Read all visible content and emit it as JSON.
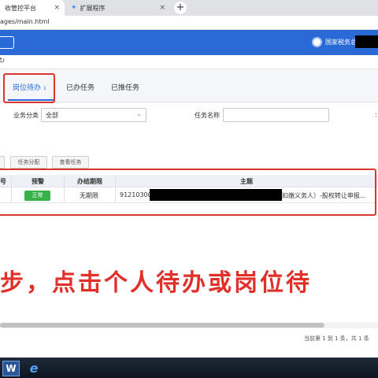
{
  "browser": {
    "tabs": [
      {
        "title": "收管控平台",
        "close": "×"
      },
      {
        "title": "扩展程序",
        "close": "×"
      }
    ],
    "new_tab": "+",
    "url": "ages/main.html"
  },
  "header": {
    "user_name": "国家税务总"
  },
  "tabs": {
    "items": [
      {
        "label": "岗位待办",
        "badge": "1"
      },
      {
        "label": "已办任务"
      },
      {
        "label": "已推任务"
      }
    ]
  },
  "filters": {
    "business_category_label": "业务分类",
    "business_category_value": "全部",
    "task_name_label": "任务名称",
    "task_name_value": ""
  },
  "toolbar": {
    "assign_label": "任务分配",
    "view_label": "查看任务"
  },
  "table": {
    "headers": [
      "号",
      "预警",
      "办结期限",
      "主题"
    ],
    "rows": [
      {
        "warning": "正常",
        "deadline": "无期限",
        "subject_prefix": "912103000",
        "subject_suffix": "扣缴义务人）-股权转让申报..."
      }
    ]
  },
  "instruction": "步，点击个人待办或岗位待",
  "pagination": "当前第 1 到 1 条，共 1 条",
  "colors": {
    "brand_blue": "#2a6ad6",
    "highlight_red": "#d9372d",
    "status_green": "#36b24a"
  }
}
